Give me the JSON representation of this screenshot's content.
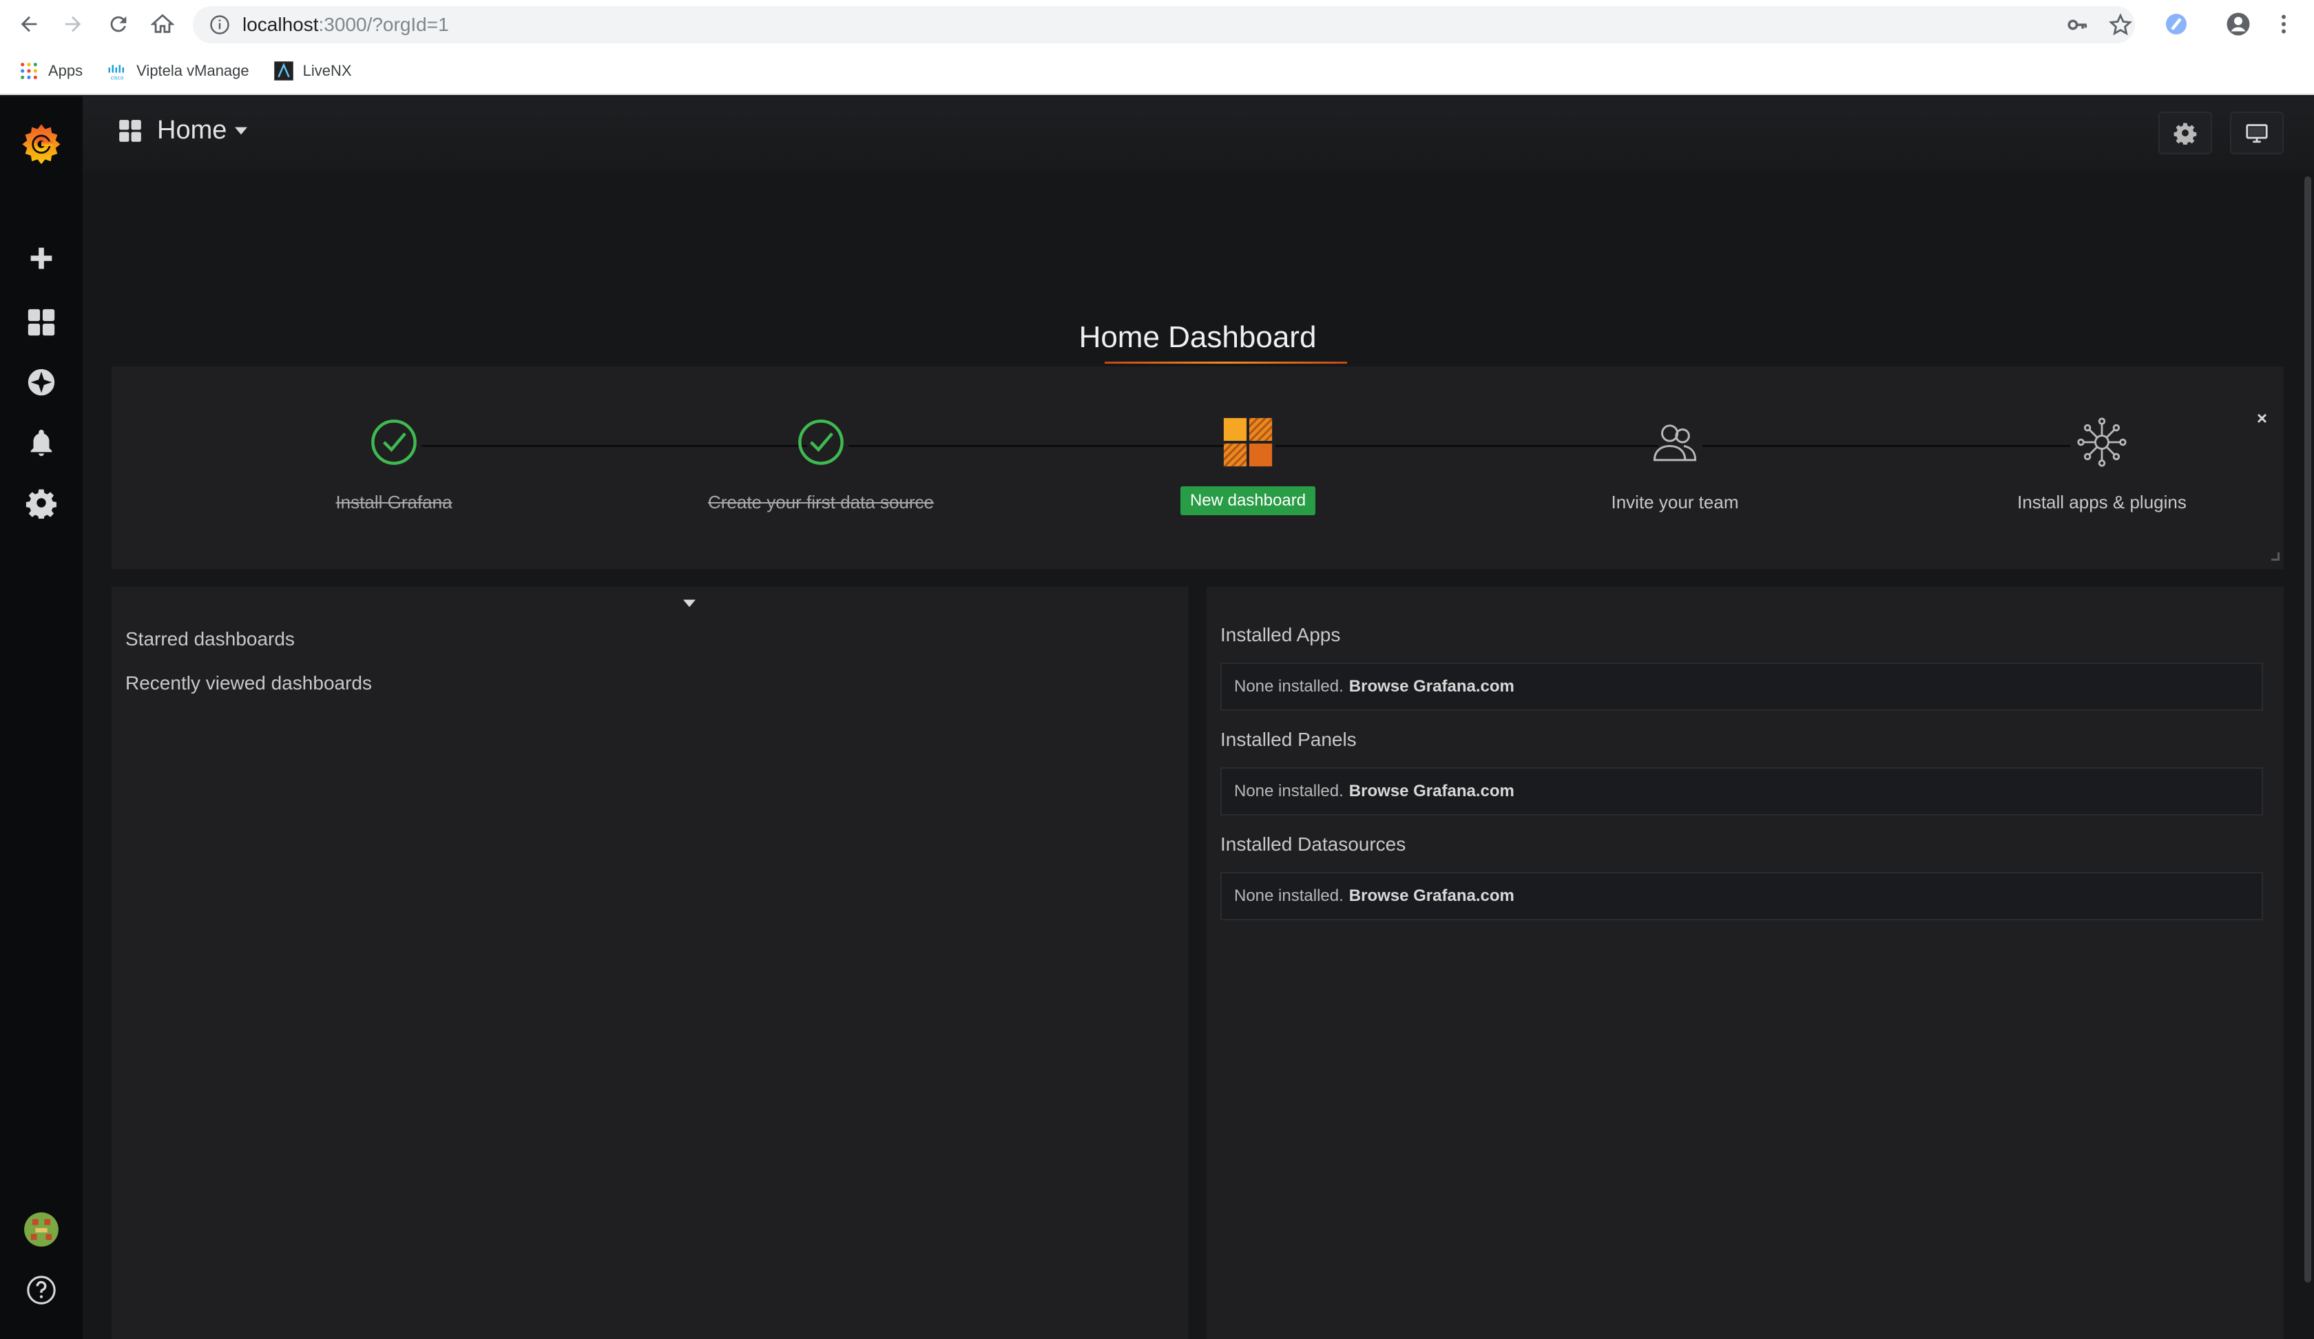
{
  "browser": {
    "url_host": "localhost",
    "url_path": ":3000/?orgId=1",
    "bookmarks": [
      {
        "label": "Apps",
        "icon": "apps-grid-icon"
      },
      {
        "label": "Viptela vManage",
        "icon": "cisco-icon"
      },
      {
        "label": "LiveNX",
        "icon": "livenx-icon"
      }
    ]
  },
  "navbar": {
    "dashboard_title": "Home"
  },
  "home_panel": {
    "title": "Home Dashboard"
  },
  "getting_started": {
    "steps": [
      {
        "label": "Install Grafana",
        "done": true,
        "icon": "check-circle-icon"
      },
      {
        "label": "Create your first data source",
        "done": true,
        "icon": "check-circle-icon"
      },
      {
        "label": "New dashboard",
        "done": false,
        "icon": "dashboard-tiles-icon",
        "is_button": true
      },
      {
        "label": "Invite your team",
        "done": false,
        "icon": "users-icon"
      },
      {
        "label": "Install apps & plugins",
        "done": false,
        "icon": "plugins-icon"
      }
    ],
    "close_label": "×"
  },
  "left_panel": {
    "starred": "Starred dashboards",
    "recent": "Recently viewed dashboards"
  },
  "right_panel": {
    "sections": [
      {
        "heading": "Installed Apps",
        "text": "None installed.",
        "link": "Browse Grafana.com"
      },
      {
        "heading": "Installed Panels",
        "text": "None installed.",
        "link": "Browse Grafana.com"
      },
      {
        "heading": "Installed Datasources",
        "text": "None installed.",
        "link": "Browse Grafana.com"
      }
    ]
  },
  "colors": {
    "accent_orange": "#f58b24",
    "success_green": "#299c46",
    "check_green": "#3fb950"
  }
}
